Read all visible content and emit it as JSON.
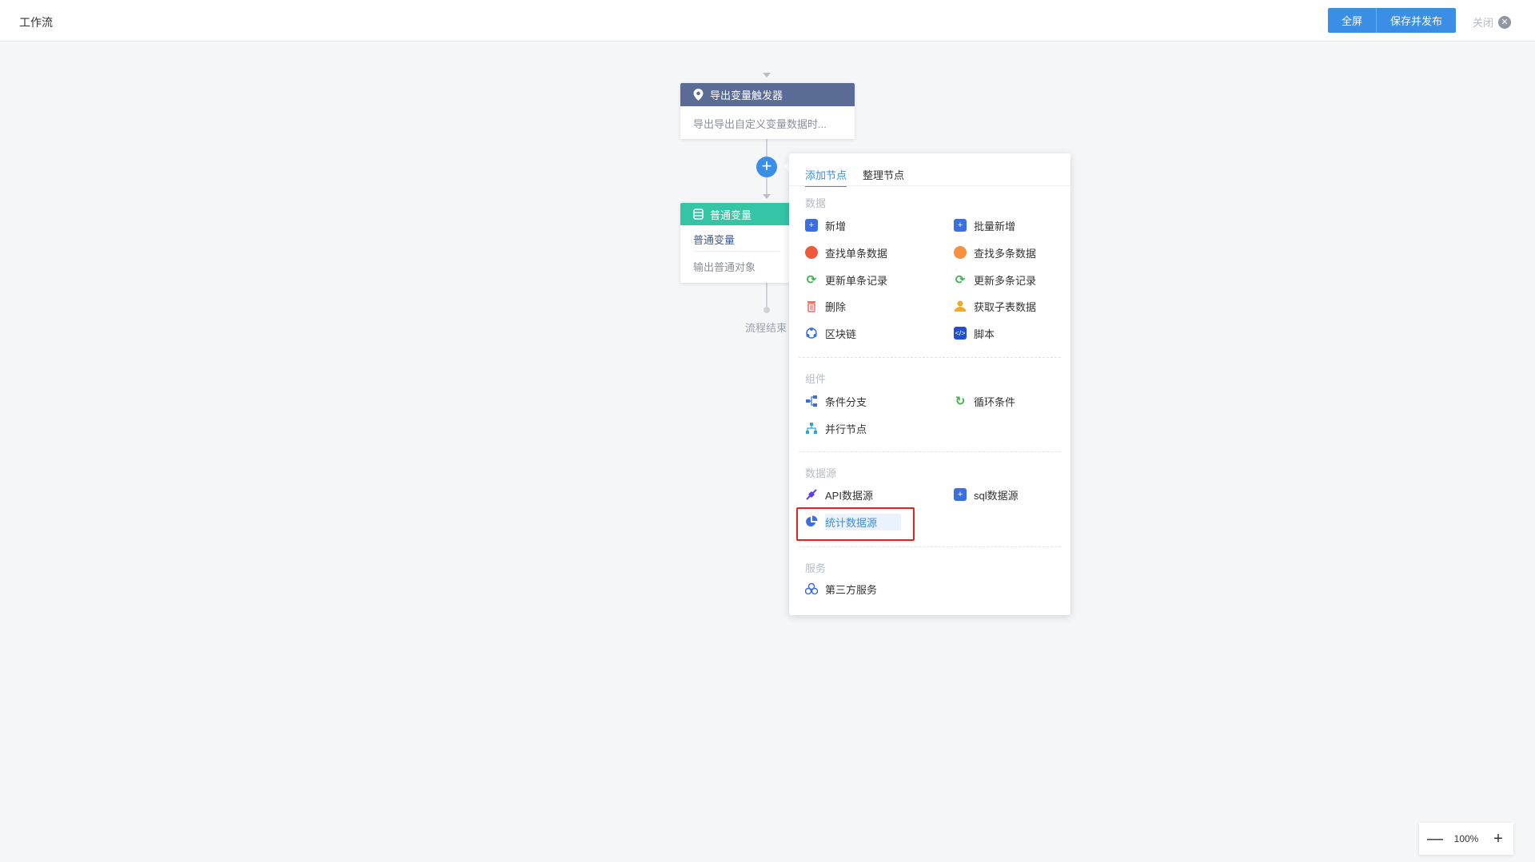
{
  "header": {
    "title": "工作流",
    "fullscreen_label": "全屏",
    "save_publish_label": "保存并发布",
    "close_label": "关闭"
  },
  "canvas": {
    "trigger": {
      "title": "导出变量触发器",
      "desc": "导出导出自定义变量数据时..."
    },
    "variable": {
      "title": "普通变量",
      "row1": "普通变量",
      "row2": "输出普通对象"
    },
    "end_label": "流程结束"
  },
  "popup": {
    "tabs": [
      "添加节点",
      "整理节点"
    ],
    "sections": {
      "data": {
        "title": "数据",
        "items": [
          "新增",
          "批量新增",
          "查找单条数据",
          "查找多条数据",
          "更新单条记录",
          "更新多条记录",
          "删除",
          "获取子表数据",
          "区块链",
          "脚本"
        ]
      },
      "component": {
        "title": "组件",
        "items": [
          "条件分支",
          "循环条件",
          "并行节点"
        ]
      },
      "datasource": {
        "title": "数据源",
        "items": [
          "API数据源",
          "sql数据源",
          "统计数据源"
        ]
      },
      "service": {
        "title": "服务",
        "items": [
          "第三方服务"
        ]
      }
    }
  },
  "zoom": {
    "value": "100%"
  },
  "colors": {
    "primary": "#3a8ee6",
    "trigger_header": "#5a6b96",
    "variable_header": "#35c4a5",
    "highlight_box": "#e2231a"
  },
  "icons": {
    "trigger": "location-pin-icon",
    "variable": "database-icon",
    "add": "plus-icon",
    "close": "close-icon"
  }
}
